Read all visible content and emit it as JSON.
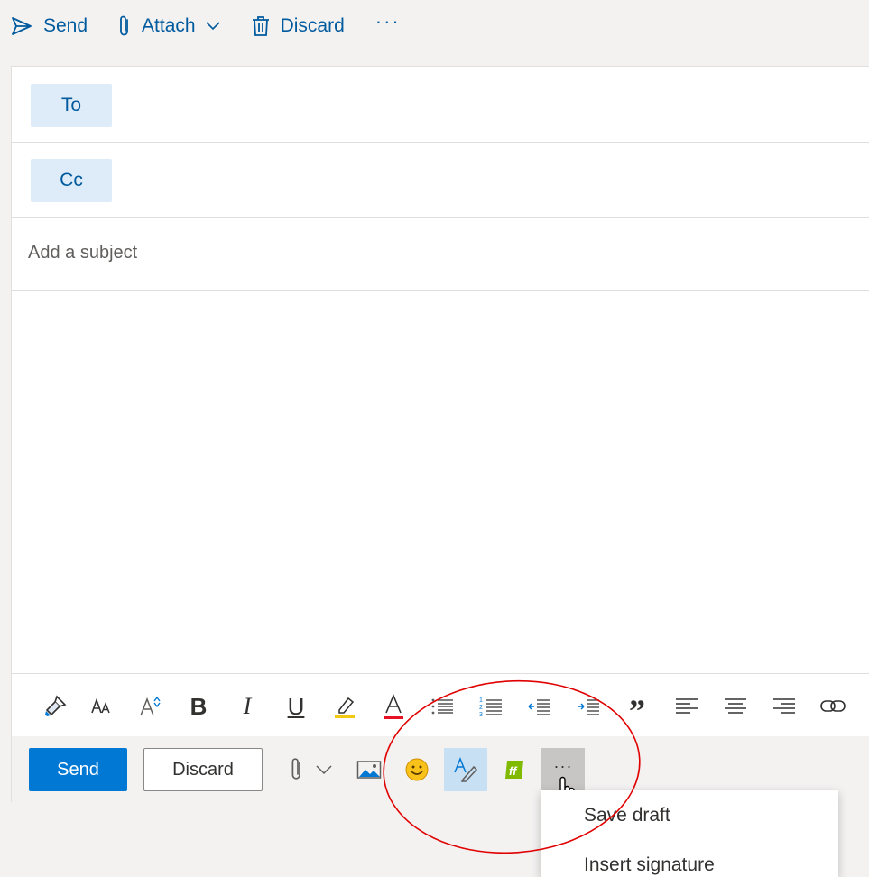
{
  "topbar": {
    "send_label": "Send",
    "attach_label": "Attach",
    "discard_label": "Discard",
    "more_label": "···"
  },
  "fields": {
    "to_label": "To",
    "cc_label": "Cc",
    "subject_placeholder": "Add a subject"
  },
  "format_toolbar": {
    "items": [
      "format-painter-icon",
      "font-size-icon",
      "grow-font-icon",
      "bold-icon",
      "italic-icon",
      "underline-icon",
      "highlight-icon",
      "font-color-icon",
      "bullets-icon",
      "numbering-icon",
      "decrease-indent-icon",
      "increase-indent-icon",
      "quote-icon",
      "align-left-icon",
      "align-center-icon",
      "align-right-icon",
      "link-icon"
    ],
    "bold_glyph": "B",
    "italic_glyph": "I",
    "underline_glyph": "U",
    "font_color_glyph": "A",
    "quote_glyph": "”"
  },
  "action_bar": {
    "send_label": "Send",
    "discard_label": "Discard",
    "more_label": "···"
  },
  "menu": {
    "items": [
      "Save draft",
      "Insert signature"
    ]
  },
  "colors": {
    "accent": "#0078d4",
    "link_blue": "#005a9e",
    "annotation_red": "#e00000",
    "addin_green": "#7fba00"
  }
}
